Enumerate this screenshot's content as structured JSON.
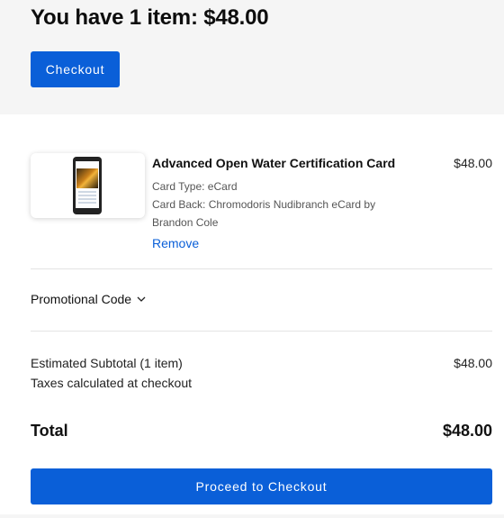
{
  "header": {
    "title": "You have 1 item: $48.00",
    "checkout_label": "Checkout"
  },
  "cart_item": {
    "name": "Advanced Open Water Certification Card",
    "price": "$48.00",
    "card_type": "Card Type: eCard",
    "card_back": "Card Back: Chromodoris Nudibranch eCard by Brandon Cole",
    "remove_label": "Remove",
    "thumbnail_icon": "phone-card-preview"
  },
  "promo": {
    "label": "Promotional Code",
    "icon": "chevron-down-icon"
  },
  "summary": {
    "subtotal_label": "Estimated Subtotal (1 item)",
    "subtotal_value": "$48.00",
    "taxes_note": "Taxes calculated at checkout",
    "total_label": "Total",
    "total_value": "$48.00"
  },
  "footer": {
    "proceed_label": "Proceed to Checkout"
  },
  "colors": {
    "accent": "#0a5fd8",
    "header_bg": "#f5f5f5"
  }
}
